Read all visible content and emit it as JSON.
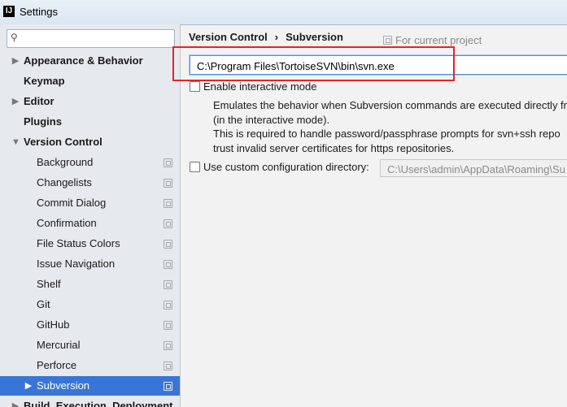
{
  "window": {
    "title": "Settings",
    "app_icon_text": "IJ"
  },
  "search": {
    "placeholder": "",
    "value": ""
  },
  "sidebar": {
    "items": [
      {
        "label": "Appearance & Behavior",
        "level": 0,
        "arrow": "▶"
      },
      {
        "label": "Keymap",
        "level": 0
      },
      {
        "label": "Editor",
        "level": 0,
        "arrow": "▶"
      },
      {
        "label": "Plugins",
        "level": 0
      },
      {
        "label": "Version Control",
        "level": 0,
        "arrow": "▼"
      },
      {
        "label": "Background",
        "level": 1
      },
      {
        "label": "Changelists",
        "level": 1
      },
      {
        "label": "Commit Dialog",
        "level": 1
      },
      {
        "label": "Confirmation",
        "level": 1
      },
      {
        "label": "File Status Colors",
        "level": 1
      },
      {
        "label": "Issue Navigation",
        "level": 1
      },
      {
        "label": "Shelf",
        "level": 1
      },
      {
        "label": "Git",
        "level": 1
      },
      {
        "label": "GitHub",
        "level": 1
      },
      {
        "label": "Mercurial",
        "level": 1
      },
      {
        "label": "Perforce",
        "level": 1
      },
      {
        "label": "Subversion",
        "level": 1,
        "arrow": "▶",
        "selected": true
      },
      {
        "label": "Build, Execution, Deployment",
        "level": 0,
        "arrow": "▶"
      }
    ]
  },
  "header": {
    "crumb_parent": "Version Control",
    "crumb_sep": "›",
    "crumb_current": "Subversion",
    "for_project": "For current project"
  },
  "subversion": {
    "executable_path": "C:\\Program Files\\TortoiseSVN\\bin\\svn.exe",
    "interactive_label": "Enable interactive mode",
    "interactive_checked": false,
    "description_lines": [
      "Emulates the behavior when Subversion commands are executed directly fr",
      "(in the interactive mode).",
      "This is required to handle password/passphrase prompts for svn+ssh repo",
      "trust invalid server certificates for https repositories."
    ],
    "config_label": "Use custom configuration directory:",
    "config_checked": false,
    "config_path": "C:\\Users\\admin\\AppData\\Roaming\\Su"
  },
  "colors": {
    "selection": "#3875d7",
    "annotation_box": "#e0262b",
    "sidebar_bg": "#e6e9ee"
  }
}
